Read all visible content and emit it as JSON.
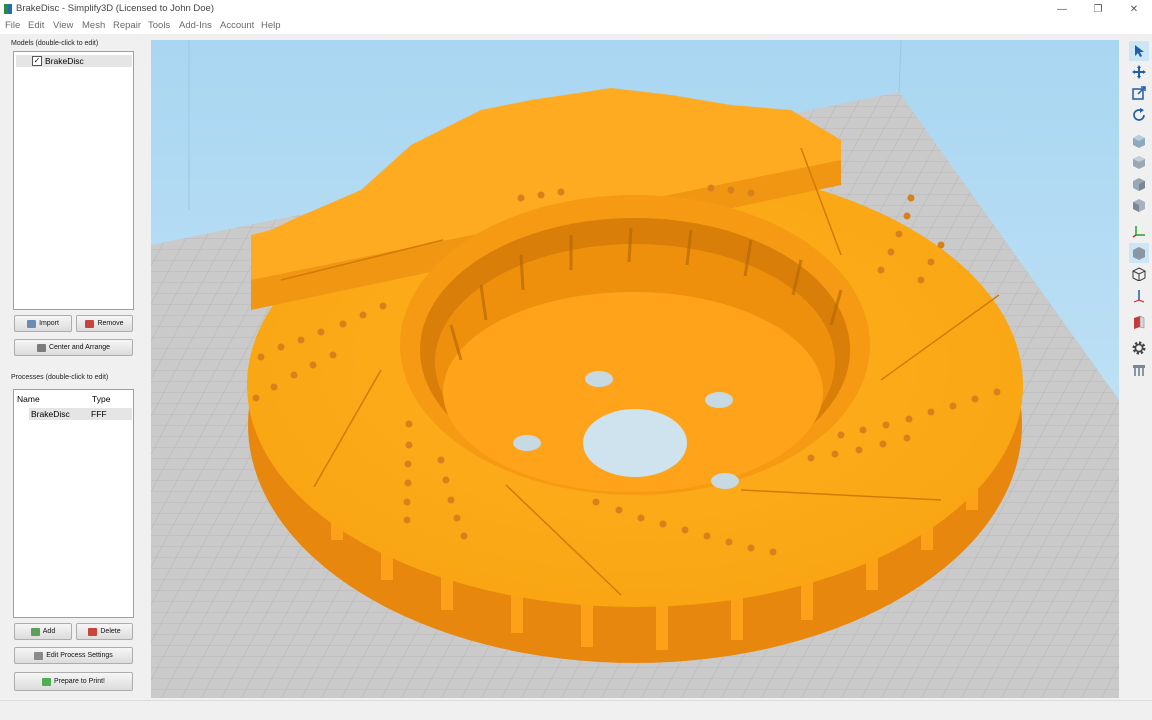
{
  "window": {
    "title": "BrakeDisc - Simplify3D (Licensed to John Doe)",
    "minimize_glyph": "—",
    "maximize_glyph": "❐",
    "close_glyph": "✕"
  },
  "menu": [
    "File",
    "Edit",
    "View",
    "Mesh",
    "Repair",
    "Tools",
    "Add-Ins",
    "Account",
    "Help"
  ],
  "models": {
    "caption": "Models (double-click to edit)",
    "items": [
      {
        "name": "BrakeDisc",
        "checked": true
      }
    ],
    "import_label": "Import",
    "remove_label": "Remove",
    "center_label": "Center and Arrange"
  },
  "processes": {
    "caption": "Processes (double-click to edit)",
    "columns": [
      "Name",
      "Type"
    ],
    "rows": [
      {
        "name": "BrakeDisc",
        "type": "FFF"
      }
    ],
    "add_label": "Add",
    "delete_label": "Delete",
    "edit_label": "Edit Process Settings",
    "prepare_label": "Prepare to Print!"
  },
  "toolbar": [
    "select-tool-icon",
    "move-tool-icon",
    "scale-tool-icon",
    "rotate-tool-icon",
    "view-isometric-icon",
    "view-front-icon",
    "view-top-icon",
    "view-side-icon",
    "axes-icon",
    "solid-view-icon",
    "wireframe-view-icon",
    "axis-z-icon",
    "cross-section-icon",
    "settings-gear-icon",
    "supports-icon"
  ],
  "colors": {
    "model": "#ffa41a",
    "model_dark": "#e88a0c",
    "bed": "#c9c9c9",
    "sky": "#b6dcf2",
    "selection": "#cde6f7"
  }
}
